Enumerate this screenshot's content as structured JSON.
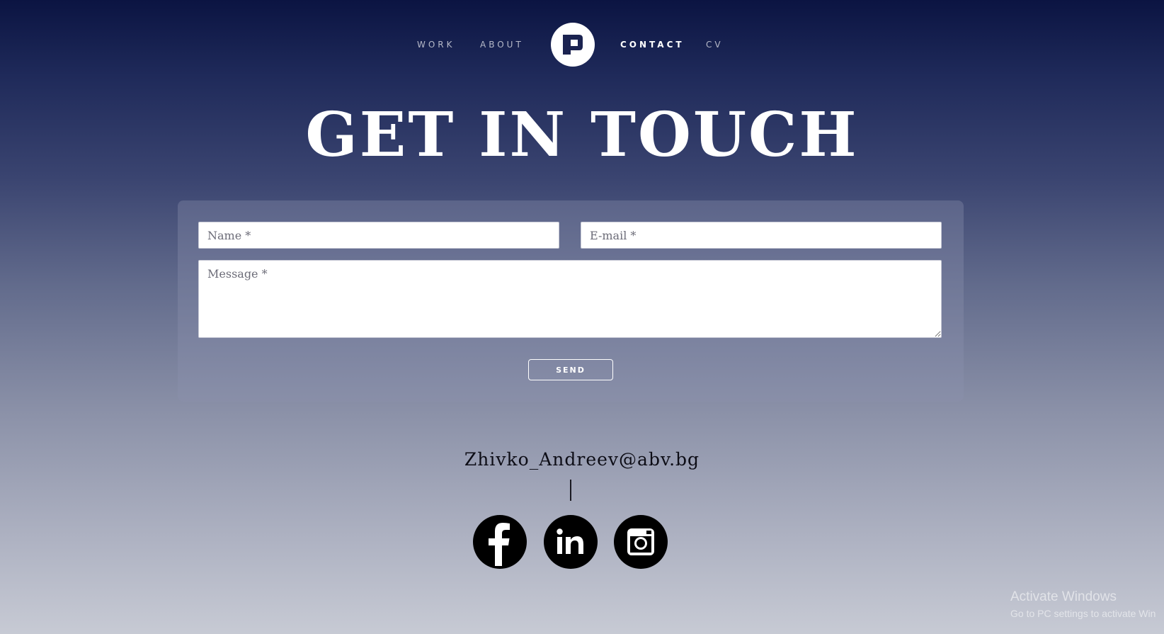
{
  "nav": {
    "items": [
      {
        "label": "WORK",
        "active": false
      },
      {
        "label": "ABOUT",
        "active": false
      },
      {
        "label": "CONTACT",
        "active": true
      },
      {
        "label": "CV",
        "active": false
      }
    ],
    "logo_icon": "monogram-logo-icon"
  },
  "page_title": "GET IN TOUCH",
  "form": {
    "name_placeholder": "Name *",
    "email_placeholder": "E-mail *",
    "message_placeholder": "Message *",
    "send_label": "SEND"
  },
  "contact": {
    "email": "Zhivko_Andreev@abv.bg"
  },
  "social": [
    {
      "name": "facebook-icon"
    },
    {
      "name": "linkedin-icon"
    },
    {
      "name": "instagram-icon"
    }
  ],
  "windows_watermark": {
    "title": "Activate Windows",
    "subtitle": "Go to PC settings to activate Win"
  },
  "colors": {
    "background_top": "#0b1442",
    "background_bottom": "#c7cad4",
    "accent": "#ffffff"
  }
}
